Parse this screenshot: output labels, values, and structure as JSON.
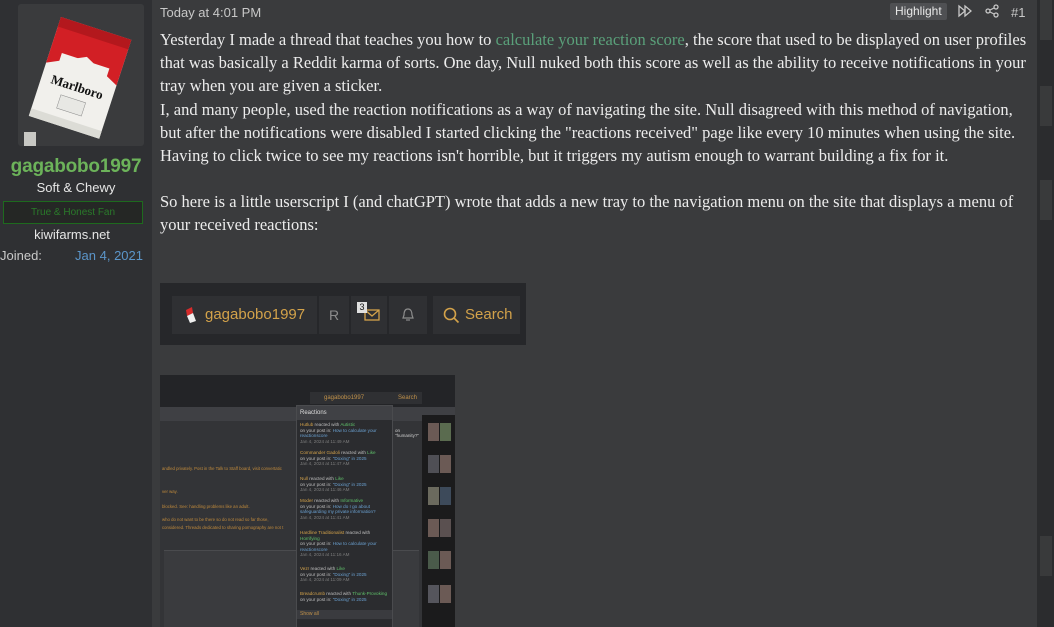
{
  "user": {
    "username": "gagabobo1997",
    "user_title": "Soft & Chewy",
    "banner": "True & Honest Fan",
    "site": "kiwifarms.net",
    "joined_label": "Joined:",
    "joined_date": "Jan 4, 2021",
    "avatar_text": "Marlboro"
  },
  "post": {
    "date": "Today at 4:01 PM",
    "highlight_label": "Highlight",
    "post_number": "#1",
    "p1_before_link": "Yesterday I made a thread that teaches you how to ",
    "p1_link": "calculate your reaction score",
    "p1_after_link": ", the score that used to be displayed on user profiles that was basically a Reddit karma of sorts. One day, Null nuked both this score as well as the ability to receive notifications in your tray when you are given a sticker.",
    "p2": "I, and many people, used the reaction notifications as a way of navigating the site. Null disagreed with this method of navigation, but after the notifications were disabled I started clicking the \"reactions received\" page like every 10 minutes when using the site. Having to click twice to see my reactions isn't horrible, but it triggers my autism enough to warrant building a fix for it.",
    "p3": "So here is a little userscript I (and chatGPT) wrote that adds a new tray to the navigation menu on the site that displays a menu of your received reactions:"
  },
  "nav_screenshot": {
    "username": "gagabobo1997",
    "r_label": "R",
    "mail_badge": "3",
    "search_label": "Search"
  },
  "reactions_screenshot": {
    "nav_user": "gagabobo1997",
    "nav_search": "Search",
    "popup_title": "Reactions",
    "items": [
      {
        "user": "Hutlub",
        "verb": " reacted with ",
        "reaction": "Autistic",
        "post": "on your post in: ",
        "thread": "How to calculate your reactionscore",
        "time": "Jan 4, 2024 at 11:49 AM"
      },
      {
        "user": "Commander Gadoli",
        "verb": " reacted with ",
        "reaction": "Like",
        "post": "on your post in: ",
        "thread": "\"Doxing\" in 2025",
        "time": "Jan 4, 2024 at 11:47 AM"
      },
      {
        "user": "Null",
        "verb": " reacted with ",
        "reaction": "Like",
        "post": "on your post in: ",
        "thread": "\"Doxing\" in 2025",
        "time": "Jan 4, 2024 at 11:46 AM"
      },
      {
        "user": "Moder",
        "verb": " reacted with ",
        "reaction": "Informative",
        "post": "on your post in: ",
        "thread": "How do I go about safeguarding my private information?",
        "time": "Jan 4, 2024 at 11:41 AM"
      },
      {
        "user": "Hardline Traditionalist",
        "verb": " reacted with ",
        "reaction": "Horrifying",
        "post": "on your post in: ",
        "thread": "How to calculate your reactionscore",
        "time": "Jan 4, 2024 at 11:16 AM"
      },
      {
        "user": "Vezr",
        "verb": " reacted with ",
        "reaction": "Like",
        "post": "on your post in: ",
        "thread": "\"Doxing\" in 2025",
        "time": "Jan 4, 2024 at 11:09 AM"
      },
      {
        "user": "Breadcrumb",
        "verb": " reacted with ",
        "reaction": "Thunk-Provoking",
        "post": "on your post in: ",
        "thread": "\"Doxing\" in 2025",
        "time": ""
      }
    ],
    "show_all": "Show all",
    "side_text": "on \"humanity?\"",
    "bg_lines": [
      "andled privately. Post in the Talk to Staff board, visit convertatic",
      "ver way.",
      "blocked. See: handling problems like an adult.",
      "who do not want to be there so do not read so far those,",
      "considered. Threads dedicated to sharing pornography are not t"
    ]
  }
}
